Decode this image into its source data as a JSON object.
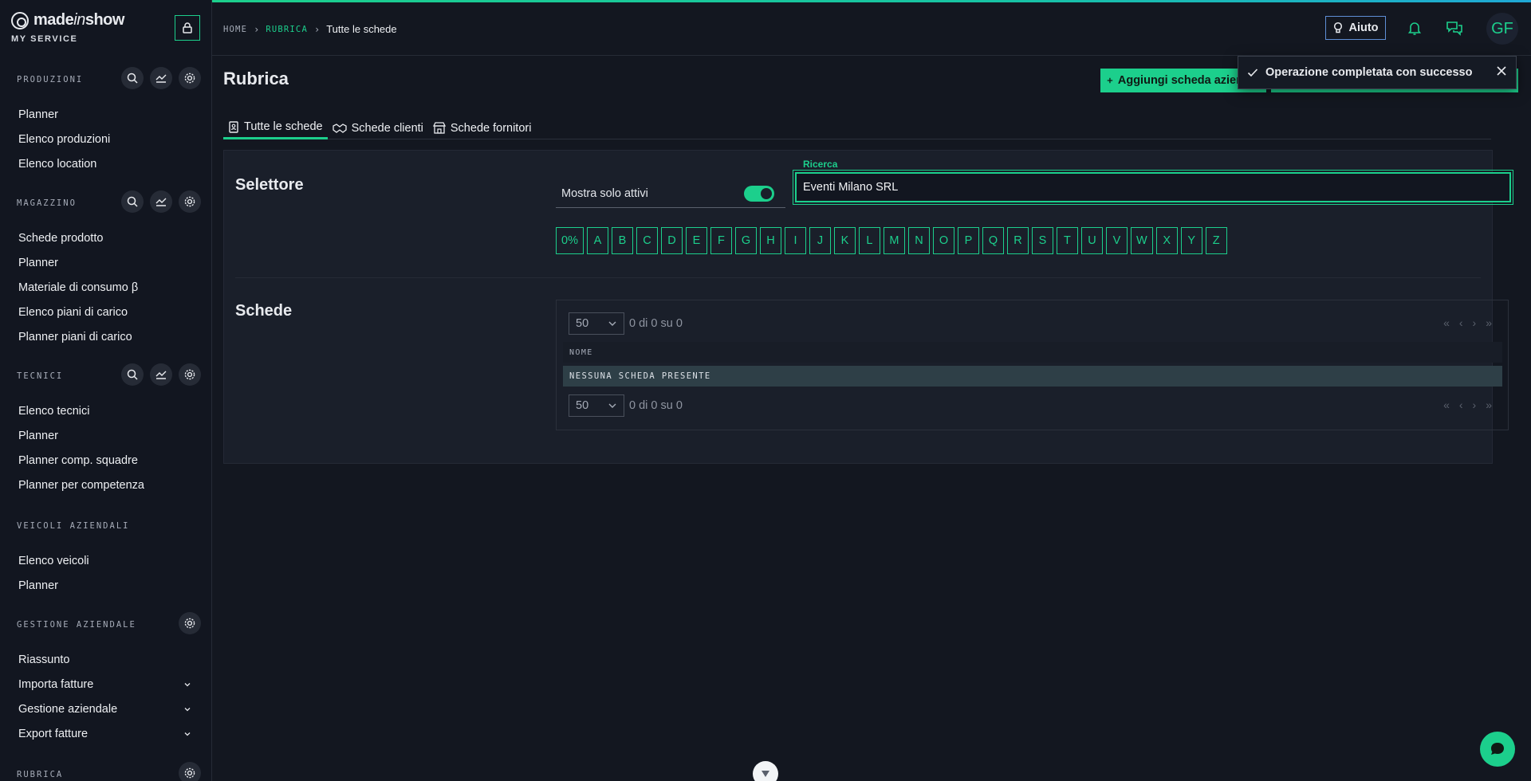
{
  "brand": {
    "name_main": "made",
    "name_italic": "in",
    "name_end": "show",
    "subtitle": "MY SERVICE"
  },
  "sidebar": {
    "sections": [
      {
        "title": "PRODUZIONI",
        "items": [
          "Planner",
          "Elenco produzioni",
          "Elenco location"
        ]
      },
      {
        "title": "MAGAZZINO",
        "items": [
          "Schede prodotto",
          "Planner",
          "Materiale di consumo β",
          "Elenco piani di carico",
          "Planner piani di carico"
        ]
      },
      {
        "title": "TECNICI",
        "items": [
          "Elenco tecnici",
          "Planner",
          "Planner comp. squadre",
          "Planner per competenza"
        ]
      },
      {
        "title": "VEICOLI AZIENDALI",
        "items": [
          "Elenco veicoli",
          "Planner"
        ]
      },
      {
        "title": "GESTIONE AZIENDALE",
        "items": [
          "Riassunto",
          "Importa fatture",
          "Gestione aziendale",
          "Export fatture"
        ]
      },
      {
        "title": "RUBRICA",
        "items": []
      }
    ]
  },
  "header": {
    "breadcrumb": {
      "home": "HOME",
      "section": "RUBRICA",
      "current": "Tutte le schede"
    },
    "help_label": "Aiuto",
    "avatar_initials": "GF"
  },
  "main": {
    "title": "Rubrica",
    "add_button": "Aggiungi scheda aziendale",
    "toast": "Operazione completata con successo",
    "tabs": [
      "Tutte le schede",
      "Schede clienti",
      "Schede fornitori"
    ],
    "selector": {
      "title": "Selettore",
      "toggle_label": "Mostra solo attivi",
      "search_label": "Ricerca",
      "search_value": "Eventi Milano SRL",
      "letters": [
        "0%",
        "A",
        "B",
        "C",
        "D",
        "E",
        "F",
        "G",
        "H",
        "I",
        "J",
        "K",
        "L",
        "M",
        "N",
        "O",
        "P",
        "Q",
        "R",
        "S",
        "T",
        "U",
        "V",
        "W",
        "X",
        "Y",
        "Z"
      ]
    },
    "records": {
      "title": "Schede",
      "page_size": "50",
      "page_info": "0 di 0 su 0",
      "column_name": "NOME",
      "empty_text": "NESSUNA SCHEDA PRESENTE"
    }
  },
  "colors": {
    "accent": "#1ccf8c",
    "background": "#131720",
    "panel": "#1a1f2a",
    "help_border": "#5f8fd6"
  }
}
